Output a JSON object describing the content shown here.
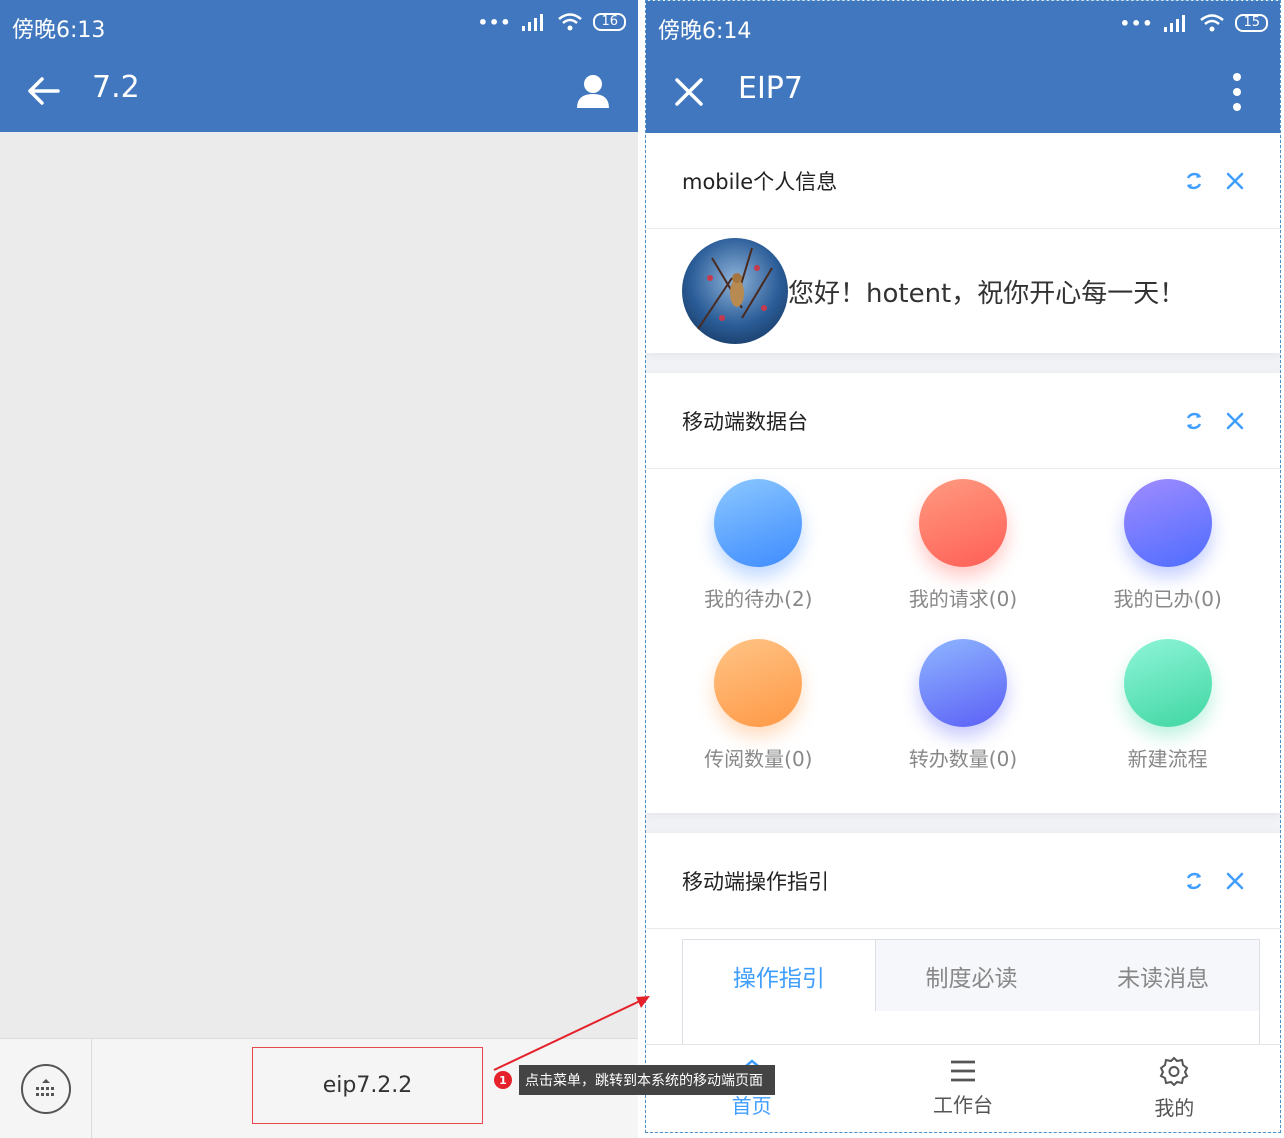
{
  "left_phone": {
    "status": {
      "time": "傍晚6:13",
      "battery": "16"
    },
    "appbar": {
      "title": "7.2"
    },
    "menu_label": "eip7.2.2"
  },
  "right_phone": {
    "status": {
      "time": "傍晚6:14",
      "battery": "15"
    },
    "appbar": {
      "title": "EIP7"
    },
    "card_profile": {
      "title": "mobile个人信息",
      "greeting": "您好！hotent，祝你开心每一天！"
    },
    "card_data": {
      "title": "移动端数据台",
      "items": [
        {
          "label": "我的待办(2)",
          "color_a": "#8cc8ff",
          "color_b": "#3d8bff"
        },
        {
          "label": "我的请求(0)",
          "color_a": "#ff9a80",
          "color_b": "#ff5f56"
        },
        {
          "label": "我的已办(0)",
          "color_a": "#a08cff",
          "color_b": "#4d6cff"
        },
        {
          "label": "传阅数量(0)",
          "color_a": "#ffc486",
          "color_b": "#ff9845"
        },
        {
          "label": "转办数量(0)",
          "color_a": "#8fb6ff",
          "color_b": "#5b5ff6"
        },
        {
          "label": "新建流程",
          "color_a": "#8ff5d8",
          "color_b": "#3fd6a2"
        }
      ]
    },
    "card_guide": {
      "title": "移动端操作指引",
      "tabs": [
        "操作指引",
        "制度必读",
        "未读消息"
      ]
    },
    "navbar": {
      "home": "首页",
      "workbench": "工作台",
      "mine": "我的"
    }
  },
  "annotation": {
    "badge": "1",
    "tooltip": "点击菜单，跳转到本系统的移动端页面",
    "color": "#e5222b"
  }
}
